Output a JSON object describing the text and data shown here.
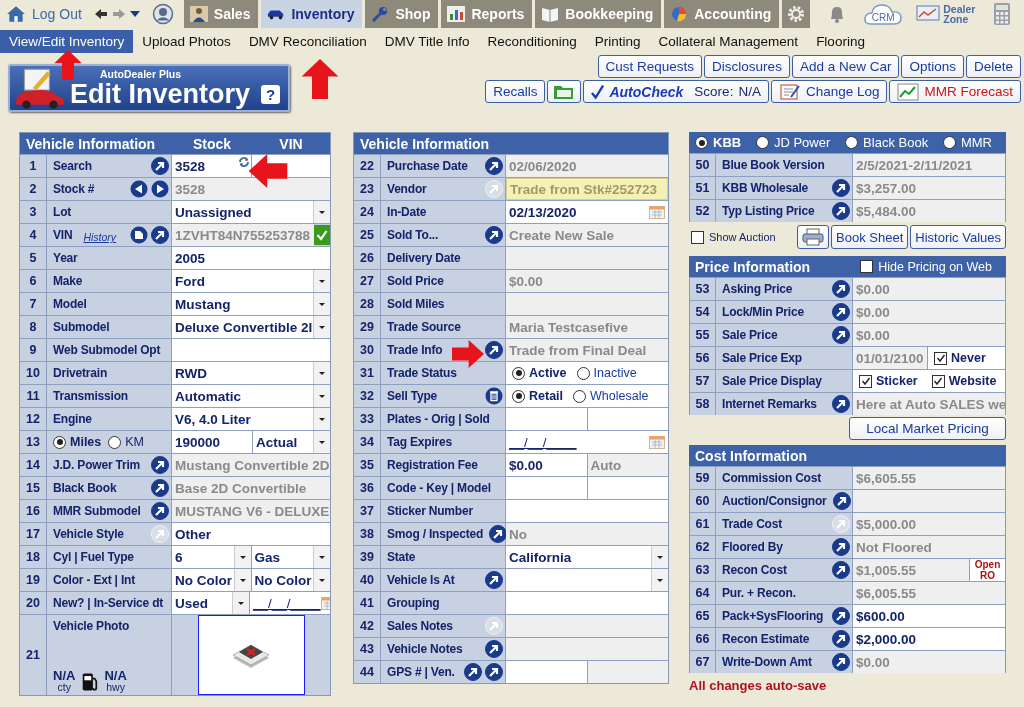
{
  "nav": {
    "logout": "Log Out",
    "tabs": [
      {
        "label": "Sales",
        "selected": false
      },
      {
        "label": "Inventory",
        "selected": true
      },
      {
        "label": "Shop",
        "selected": false
      },
      {
        "label": "Reports",
        "selected": false
      },
      {
        "label": "Bookkeeping",
        "selected": false
      },
      {
        "label": "Accounting",
        "selected": false
      }
    ],
    "crm": "CRM",
    "dealer_zone": "Dealer Zone"
  },
  "submenu": [
    {
      "label": "View/Edit Inventory",
      "selected": true
    },
    {
      "label": "Upload Photos",
      "selected": false
    },
    {
      "label": "DMV Reconciliation",
      "selected": false
    },
    {
      "label": "DMV Title Info",
      "selected": false
    },
    {
      "label": "Reconditioning",
      "selected": false
    },
    {
      "label": "Printing",
      "selected": false
    },
    {
      "label": "Collateral Management",
      "selected": false
    },
    {
      "label": "Flooring",
      "selected": false
    }
  ],
  "header": {
    "brand": "AutoDealer Plus",
    "title": "Edit Inventory",
    "help": "?"
  },
  "actions_top": [
    "Cust Requests",
    "Disclosures",
    "Add a New Car",
    "Options",
    "Delete"
  ],
  "actions_bottom": {
    "recalls": "Recalls",
    "autocheck": "AutoCheck",
    "score_label": "Score:",
    "score": "N/A",
    "change_log": "Change Log",
    "mmr": "MMR Forecast"
  },
  "left": {
    "headers": [
      "Vehicle Information",
      "Stock",
      "VIN"
    ],
    "rows": [
      {
        "num": "1",
        "label": "Search",
        "icons": [
          {
            "kind": "go"
          }
        ],
        "cells": [
          {
            "kind": "input",
            "text": "3528",
            "refresh": true
          },
          {
            "kind": "input"
          }
        ]
      },
      {
        "num": "2",
        "label": "Stock #",
        "icons": [
          {
            "kind": "prev"
          },
          {
            "kind": "next"
          }
        ],
        "cells": [
          {
            "kind": "readonly",
            "text": "3528"
          }
        ]
      },
      {
        "num": "3",
        "label": "Lot",
        "icons": [],
        "cells": [
          {
            "kind": "select",
            "text": "Unassigned"
          }
        ]
      },
      {
        "num": "4",
        "label": "VIN",
        "link": "History",
        "icons": [
          {
            "kind": "doc"
          },
          {
            "kind": "go"
          }
        ],
        "cells": [
          {
            "kind": "readonly",
            "text": "1ZVHT84N755253788",
            "verified": true
          }
        ]
      },
      {
        "num": "5",
        "label": "Year",
        "icons": [],
        "cells": [
          {
            "kind": "input",
            "text": "2005"
          }
        ]
      },
      {
        "num": "6",
        "label": "Make",
        "icons": [],
        "cells": [
          {
            "kind": "select",
            "text": "Ford"
          }
        ]
      },
      {
        "num": "7",
        "label": "Model",
        "icons": [],
        "cells": [
          {
            "kind": "select",
            "text": "Mustang"
          }
        ]
      },
      {
        "num": "8",
        "label": "Submodel",
        "icons": [],
        "cells": [
          {
            "kind": "select",
            "text": "Deluxe Convertible 2I"
          }
        ]
      },
      {
        "num": "9",
        "label": "Web Submodel Opt",
        "icons": [],
        "cells": [
          {
            "kind": "input"
          }
        ]
      },
      {
        "num": "10",
        "label": "Drivetrain",
        "icons": [],
        "cells": [
          {
            "kind": "select",
            "text": "RWD"
          }
        ]
      },
      {
        "num": "11",
        "label": "Transmission",
        "icons": [],
        "cells": [
          {
            "kind": "select",
            "text": "Automatic"
          }
        ]
      },
      {
        "num": "12",
        "label": "Engine",
        "icons": [],
        "cells": [
          {
            "kind": "select",
            "text": "V6, 4.0 Liter"
          }
        ]
      },
      {
        "num": "13",
        "label_options": [
          {
            "text": "Miles",
            "selected": true
          },
          {
            "text": "KM",
            "selected": false
          }
        ],
        "icons": [],
        "cells": [
          {
            "kind": "input",
            "text": "190000"
          },
          {
            "kind": "select",
            "text": "Actual"
          }
        ]
      },
      {
        "num": "14",
        "label": "J.D. Power Trim",
        "icons": [
          {
            "kind": "go"
          }
        ],
        "cells": [
          {
            "kind": "readonly",
            "text": "Mustang Convertible 2D"
          }
        ]
      },
      {
        "num": "15",
        "label": "Black Book",
        "icons": [
          {
            "kind": "go"
          }
        ],
        "cells": [
          {
            "kind": "readonly",
            "text": "Base 2D Convertible"
          }
        ]
      },
      {
        "num": "16",
        "label": "MMR Submodel",
        "icons": [
          {
            "kind": "go"
          }
        ],
        "cells": [
          {
            "kind": "readonly",
            "text": "MUSTANG V6 - DELUXE"
          }
        ]
      },
      {
        "num": "17",
        "label": "Vehicle Style",
        "icons": [
          {
            "kind": "go_off"
          }
        ],
        "cells": [
          {
            "kind": "input",
            "text": "Other"
          }
        ]
      },
      {
        "num": "18",
        "label": "Cyl | Fuel Type",
        "icons": [],
        "cells": [
          {
            "kind": "select",
            "text": "6"
          },
          {
            "kind": "select",
            "text": "Gas"
          }
        ]
      },
      {
        "num": "19",
        "label": "Color - Ext | Int",
        "icons": [],
        "cells": [
          {
            "kind": "select",
            "text": "No Color"
          },
          {
            "kind": "select",
            "text": "No Color"
          }
        ]
      },
      {
        "num": "20",
        "label": "New? | In-Service dt",
        "icons": [],
        "cells": [
          {
            "kind": "select",
            "text": "Used"
          },
          {
            "kind": "date",
            "text": "__/__/____"
          }
        ]
      }
    ],
    "photo": {
      "num": "21",
      "label": "Vehicle Photo",
      "mpg": [
        {
          "value": "N/A",
          "unit": "cty"
        },
        {
          "value": "N/A",
          "unit": "hwy"
        }
      ]
    }
  },
  "middle": {
    "title": "Vehicle Information",
    "rows": [
      {
        "num": "22",
        "label": "Purchase Date",
        "icons": [
          {
            "kind": "go"
          }
        ],
        "cells": [
          {
            "kind": "readonly",
            "text": "02/06/2020"
          }
        ]
      },
      {
        "num": "23",
        "label": "Vendor",
        "icons": [
          {
            "kind": "go_off"
          }
        ],
        "cells": [
          {
            "kind": "highlight",
            "text": "Trade from Stk#252723"
          }
        ]
      },
      {
        "num": "24",
        "label": "In-Date",
        "icons": [],
        "cells": [
          {
            "kind": "date",
            "text": "02/13/2020"
          }
        ]
      },
      {
        "num": "25",
        "label": "Sold To...",
        "icons": [
          {
            "kind": "go"
          }
        ],
        "cells": [
          {
            "kind": "readonly",
            "text": "Create New Sale"
          }
        ]
      },
      {
        "num": "26",
        "label": "Delivery Date",
        "icons": [],
        "cells": [
          {
            "kind": "readonly"
          }
        ]
      },
      {
        "num": "27",
        "label": "Sold Price",
        "icons": [],
        "cells": [
          {
            "kind": "readonly",
            "text": "$0.00"
          }
        ]
      },
      {
        "num": "28",
        "label": "Sold Miles",
        "icons": [],
        "cells": [
          {
            "kind": "readonly"
          }
        ]
      },
      {
        "num": "29",
        "label": "Trade Source",
        "icons": [],
        "cells": [
          {
            "kind": "readonly",
            "text": "Maria Testcasefive"
          }
        ]
      },
      {
        "num": "30",
        "label": "Trade Info",
        "icons": [
          {
            "kind": "go"
          }
        ],
        "cells": [
          {
            "kind": "readonly",
            "text": "Trade from Final Deal"
          }
        ]
      },
      {
        "num": "31",
        "label": "Trade Status",
        "icons": [],
        "cells": [
          {
            "kind": "radio",
            "options": [
              {
                "text": "Active",
                "selected": true
              },
              {
                "text": "Inactive",
                "selected": false
              }
            ]
          }
        ]
      },
      {
        "num": "32",
        "label": "Sell Type",
        "icons": [
          {
            "kind": "trash"
          }
        ],
        "cells": [
          {
            "kind": "radio",
            "options": [
              {
                "text": "Retail",
                "selected": true
              },
              {
                "text": "Wholesale",
                "selected": false
              }
            ]
          }
        ]
      },
      {
        "num": "33",
        "label": "Plates - Orig | Sold",
        "icons": [],
        "cells": [
          {
            "kind": "input"
          },
          {
            "kind": "input"
          }
        ]
      },
      {
        "num": "34",
        "label": "Tag Expires",
        "icons": [],
        "cells": [
          {
            "kind": "date",
            "text": "__/__/____"
          }
        ]
      },
      {
        "num": "35",
        "label": "Registration Fee",
        "icons": [],
        "cells": [
          {
            "kind": "input",
            "text": "$0.00"
          },
          {
            "kind": "readonly",
            "text": "Auto"
          }
        ]
      },
      {
        "num": "36",
        "label": "Code - Key | Model",
        "icons": [],
        "cells": [
          {
            "kind": "input"
          },
          {
            "kind": "input"
          }
        ]
      },
      {
        "num": "37",
        "label": "Sticker Number",
        "icons": [],
        "cells": [
          {
            "kind": "input"
          }
        ]
      },
      {
        "num": "38",
        "label": "Smog / Inspected",
        "icons": [
          {
            "kind": "go"
          }
        ],
        "cells": [
          {
            "kind": "readonly",
            "text": "No"
          }
        ]
      },
      {
        "num": "39",
        "label": "State",
        "icons": [],
        "cells": [
          {
            "kind": "select",
            "text": "California"
          }
        ]
      },
      {
        "num": "40",
        "label": "Vehicle Is At",
        "icons": [
          {
            "kind": "go"
          }
        ],
        "cells": [
          {
            "kind": "select"
          }
        ]
      },
      {
        "num": "41",
        "label": "Grouping",
        "icons": [],
        "cells": [
          {
            "kind": "input"
          }
        ]
      },
      {
        "num": "42",
        "label": "Sales Notes",
        "icons": [
          {
            "kind": "go_off"
          }
        ],
        "cells": [
          {
            "kind": "readonly"
          }
        ]
      },
      {
        "num": "43",
        "label": "Vehicle Notes",
        "icons": [
          {
            "kind": "go"
          }
        ],
        "cells": [
          {
            "kind": "readonly"
          }
        ]
      },
      {
        "num": "44",
        "label": "GPS # | Ven.",
        "icons": [
          {
            "kind": "go"
          },
          {
            "kind": "go"
          }
        ],
        "cells": [
          {
            "kind": "input"
          },
          {
            "kind": "readonly"
          }
        ]
      }
    ]
  },
  "right": {
    "book": {
      "options": [
        {
          "text": "KBB",
          "selected": true
        },
        {
          "text": "JD Power",
          "selected": false
        },
        {
          "text": "Black Book",
          "selected": false
        },
        {
          "text": "MMR",
          "selected": false
        }
      ],
      "rows": [
        {
          "num": "50",
          "label": "Blue Book Version",
          "icons": [],
          "cells": [
            {
              "kind": "readonly",
              "text": "2/5/2021-2/11/2021"
            }
          ]
        },
        {
          "num": "51",
          "label": "KBB Wholesale",
          "icons": [
            {
              "kind": "go"
            }
          ],
          "cells": [
            {
              "kind": "readonly",
              "text": "$3,257.00"
            }
          ]
        },
        {
          "num": "52",
          "label": "Typ Listing Price",
          "icons": [
            {
              "kind": "go"
            }
          ],
          "cells": [
            {
              "kind": "readonly",
              "text": "$5,484.00"
            }
          ]
        }
      ]
    },
    "show_auction": {
      "label": "Show Auction",
      "checked": false
    },
    "book_buttons": [
      "Book Sheet",
      "Historic Values"
    ],
    "price": {
      "title": "Price Information",
      "hide": {
        "label": "Hide Pricing on Web",
        "checked": false
      },
      "rows": [
        {
          "num": "53",
          "label": "Asking Price",
          "icons": [
            {
              "kind": "go"
            }
          ],
          "cells": [
            {
              "kind": "readonly",
              "text": "$0.00"
            }
          ]
        },
        {
          "num": "54",
          "label": "Lock/Min Price",
          "icons": [
            {
              "kind": "go"
            }
          ],
          "cells": [
            {
              "kind": "readonly",
              "text": "$0.00"
            }
          ]
        },
        {
          "num": "55",
          "label": "Sale Price",
          "icons": [
            {
              "kind": "go"
            }
          ],
          "cells": [
            {
              "kind": "readonly",
              "text": "$0.00"
            }
          ]
        },
        {
          "num": "56",
          "label": "Sale Price Exp",
          "icons": [],
          "cells": [
            {
              "kind": "readonly",
              "text": "01/01/2100"
            },
            {
              "kind": "check",
              "options": [
                {
                  "text": "Never",
                  "checked": true
                }
              ]
            }
          ]
        },
        {
          "num": "57",
          "label": "Sale Price Display",
          "icons": [],
          "cells": [
            {
              "kind": "check",
              "options": [
                {
                  "text": "Sticker",
                  "checked": true
                },
                {
                  "text": "Website",
                  "checked": true
                }
              ]
            }
          ]
        },
        {
          "num": "58",
          "label": "Internet Remarks",
          "icons": [
            {
              "kind": "go"
            }
          ],
          "cells": [
            {
              "kind": "readonly",
              "text": "Here at Auto SALES we"
            }
          ]
        }
      ]
    },
    "local_button": "Local Market Pricing",
    "cost": {
      "title": "Cost Information",
      "rows": [
        {
          "num": "59",
          "label": "Commission Cost",
          "icons": [],
          "cells": [
            {
              "kind": "readonly",
              "text": "$6,605.55"
            }
          ]
        },
        {
          "num": "60",
          "label": "Auction/Consignor",
          "icons": [
            {
              "kind": "go"
            }
          ],
          "cells": [
            {
              "kind": "readonly"
            }
          ]
        },
        {
          "num": "61",
          "label": "Trade Cost",
          "icons": [
            {
              "kind": "go_off"
            }
          ],
          "cells": [
            {
              "kind": "readonly",
              "text": "$5,000.00"
            }
          ]
        },
        {
          "num": "62",
          "label": "Floored By",
          "icons": [
            {
              "kind": "go"
            }
          ],
          "cells": [
            {
              "kind": "readonly",
              "text": "Not Floored"
            }
          ]
        },
        {
          "num": "63",
          "label": "Recon Cost",
          "icons": [
            {
              "kind": "go"
            }
          ],
          "cells": [
            {
              "kind": "readonly",
              "text": "$1,005.55"
            },
            {
              "kind": "note",
              "text": "Open RO"
            }
          ]
        },
        {
          "num": "64",
          "label": "Pur. + Recon.",
          "icons": [],
          "cells": [
            {
              "kind": "readonly",
              "text": "$6,005.55"
            }
          ]
        },
        {
          "num": "65",
          "label": "Pack+SysFlooring",
          "icons": [
            {
              "kind": "go"
            }
          ],
          "cells": [
            {
              "kind": "input",
              "text": "$600.00"
            }
          ]
        },
        {
          "num": "66",
          "label": "Recon Estimate",
          "icons": [
            {
              "kind": "go"
            }
          ],
          "cells": [
            {
              "kind": "input",
              "text": "$2,000.00"
            }
          ]
        },
        {
          "num": "67",
          "label": "Write-Down Amt",
          "icons": [
            {
              "kind": "go"
            }
          ],
          "cells": [
            {
              "kind": "readonly",
              "text": "$0.00"
            }
          ]
        }
      ]
    },
    "footer": "All changes auto-save"
  }
}
